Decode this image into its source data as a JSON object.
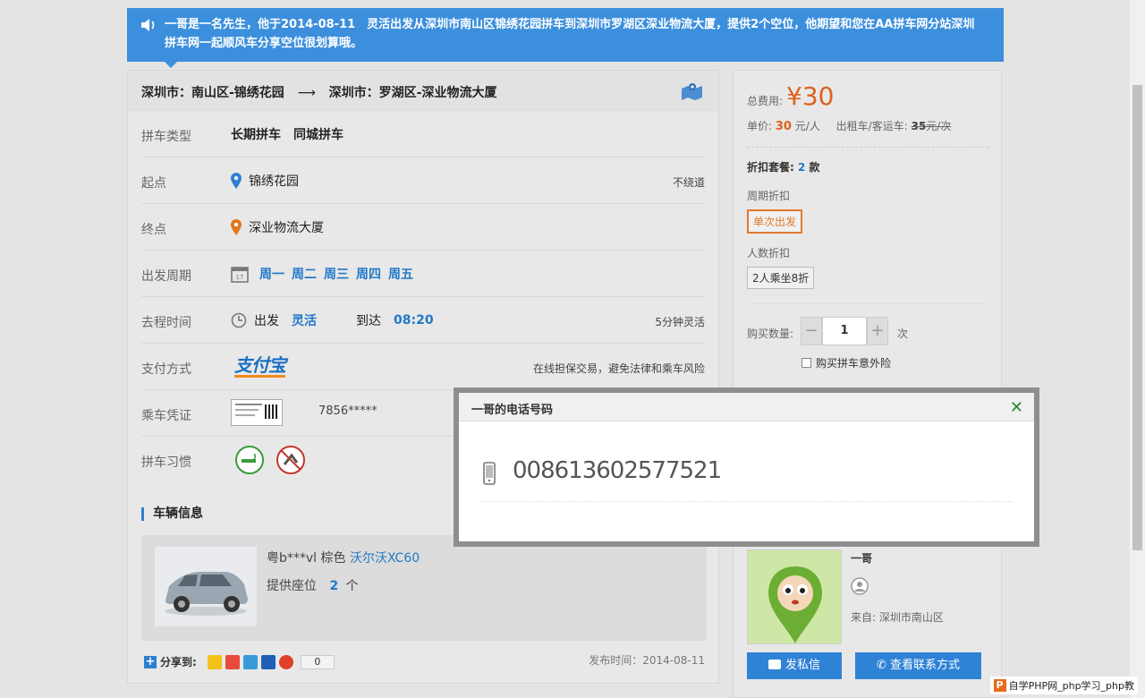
{
  "notice": {
    "text": "一哥是一名先生，他于2014-08-11　灵活出发从深圳市南山区锦绣花园拼车到深圳市罗湖区深业物流大厦，提供2个空位，他期望和您在AA拼车网分站深圳拼车网一起顺风车分享空位很划算哦。"
  },
  "route": {
    "from": "深圳市：南山区-锦绣花园",
    "arrow": "⟶",
    "to": "深圳市：罗湖区-深业物流大厦"
  },
  "details": {
    "type_label": "拼车类型",
    "type_value": "长期拼车　同城拼车",
    "start_label": "起点",
    "start_value": "锦绣花园",
    "start_note": "不绕道",
    "end_label": "终点",
    "end_value": "深业物流大厦",
    "cycle_label": "出发周期",
    "days": [
      "周一",
      "周二",
      "周三",
      "周四",
      "周五"
    ],
    "time_label": "去程时间",
    "depart_label": "出发",
    "depart_value": "灵活",
    "arrive_label": "到达",
    "arrive_value": "08:20",
    "flex_note": "5分钟灵活",
    "pay_label": "支付方式",
    "pay_logo": "支付宝",
    "pay_note": "在线担保交易，避免法律和乘车风险",
    "ticket_label": "乘车凭证",
    "ticket_code": "7856*****",
    "habit_label": "拼车习惯"
  },
  "vehicle": {
    "heading": "车辆信息",
    "plate": "粤b***vl 棕色",
    "model": "沃尔沃XC60",
    "seats_label": "提供座位",
    "seats_value": "2",
    "seats_unit": "个"
  },
  "share": {
    "label": "分享到:",
    "count": "0"
  },
  "publish": "发布时间：2014-08-11",
  "pricing": {
    "total_label": "总费用:",
    "total": "¥30",
    "unit_label": "单价:",
    "unit_value": "30",
    "unit_suffix": "元/人",
    "taxi_label": "出租车/客运车:",
    "taxi_value": "35",
    "taxi_suffix": "元/次",
    "discount_label": "折扣套餐:",
    "discount_count": "2",
    "discount_unit": "款",
    "cycle_discount_label": "周期折扣",
    "cycle_discount_option": "单次出发",
    "people_discount_label": "人数折扣",
    "people_discount_option": "2人乘坐8折",
    "qty_label": "购买数量:",
    "qty_value": "1",
    "qty_unit": "次",
    "insurance_label": "购买拼车意外险"
  },
  "driver": {
    "name": "一哥",
    "from": "来自: 深圳市南山区",
    "message_button": "发私信",
    "contact_button": "查看联系方式"
  },
  "modal": {
    "title": "一哥的电话号码",
    "close": "✕",
    "phone": "008613602577521"
  },
  "watermark": "自学PHP网_php学习_php教"
}
